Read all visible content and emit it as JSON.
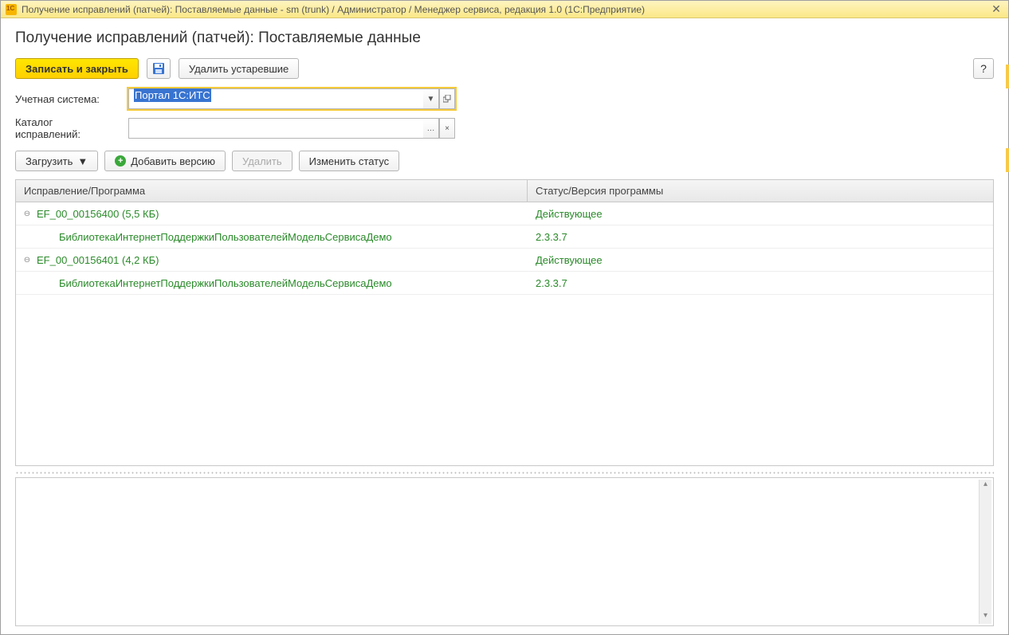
{
  "titlebar": {
    "text": "Получение исправлений (патчей): Поставляемые данные - sm (trunk) / Администратор / Менеджер сервиса, редакция 1.0  (1С:Предприятие)"
  },
  "page": {
    "title": "Получение исправлений (патчей): Поставляемые данные"
  },
  "toolbar": {
    "save_close": "Записать и закрыть",
    "delete_old": "Удалить устаревшие",
    "help": "?"
  },
  "form": {
    "system_label": "Учетная система:",
    "system_value": "Портал 1С:ИТС",
    "catalog_label": "Каталог исправлений:",
    "catalog_value": ""
  },
  "toolbar2": {
    "load": "Загрузить",
    "add_version": "Добавить версию",
    "delete": "Удалить",
    "change_status": "Изменить статус"
  },
  "table": {
    "col1": "Исправление/Программа",
    "col2": "Статус/Версия программы",
    "rows": [
      {
        "lvl": 0,
        "c1": "EF_00_00156400 (5,5 КБ)",
        "c2": "Действующее"
      },
      {
        "lvl": 1,
        "c1": "БиблиотекаИнтернетПоддержкиПользователейМодельСервисаДемо",
        "c2": "2.3.3.7"
      },
      {
        "lvl": 0,
        "c1": "EF_00_00156401 (4,2 КБ)",
        "c2": "Действующее"
      },
      {
        "lvl": 1,
        "c1": "БиблиотекаИнтернетПоддержкиПользователейМодельСервисаДемо",
        "c2": "2.3.3.7"
      }
    ]
  }
}
